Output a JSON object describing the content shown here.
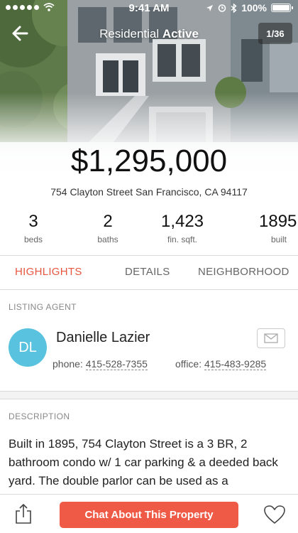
{
  "status_bar": {
    "time": "9:41 AM",
    "battery": "100%",
    "battery_level": 1.0
  },
  "nav": {
    "title_prefix": "Residential",
    "title_status": "Active",
    "photo_counter": "1/36"
  },
  "listing": {
    "price": "$1,295,000",
    "address": "754 Clayton Street San Francisco, CA 94117",
    "stats": [
      {
        "value": "3",
        "label": "beds"
      },
      {
        "value": "2",
        "label": "baths"
      },
      {
        "value": "1,423",
        "label": "fin. sqft."
      },
      {
        "value": "1895",
        "label": "built"
      }
    ]
  },
  "tabs": [
    {
      "label": "HIGHLIGHTS",
      "active": true
    },
    {
      "label": "DETAILS",
      "active": false
    },
    {
      "label": "NEIGHBORHOOD",
      "active": false
    }
  ],
  "agent_section": {
    "heading": "LISTING AGENT",
    "initials": "DL",
    "name": "Danielle Lazier",
    "phone_label": "phone:",
    "phone": "415-528-7355",
    "office_label": "office:",
    "office": "415-483-9285"
  },
  "description_section": {
    "heading": "DESCRIPTION",
    "text": "Built in 1895, 754 Clayton Street is a 3 BR, 2 bathroom condo w/ 1 car parking & a deeded back yard. The double parlor can be used as a"
  },
  "bottom_bar": {
    "chat_label": "Chat About This Property"
  },
  "colors": {
    "accent": "#e8563f",
    "chat_button": "#ee5a45",
    "avatar": "#58c2df"
  }
}
